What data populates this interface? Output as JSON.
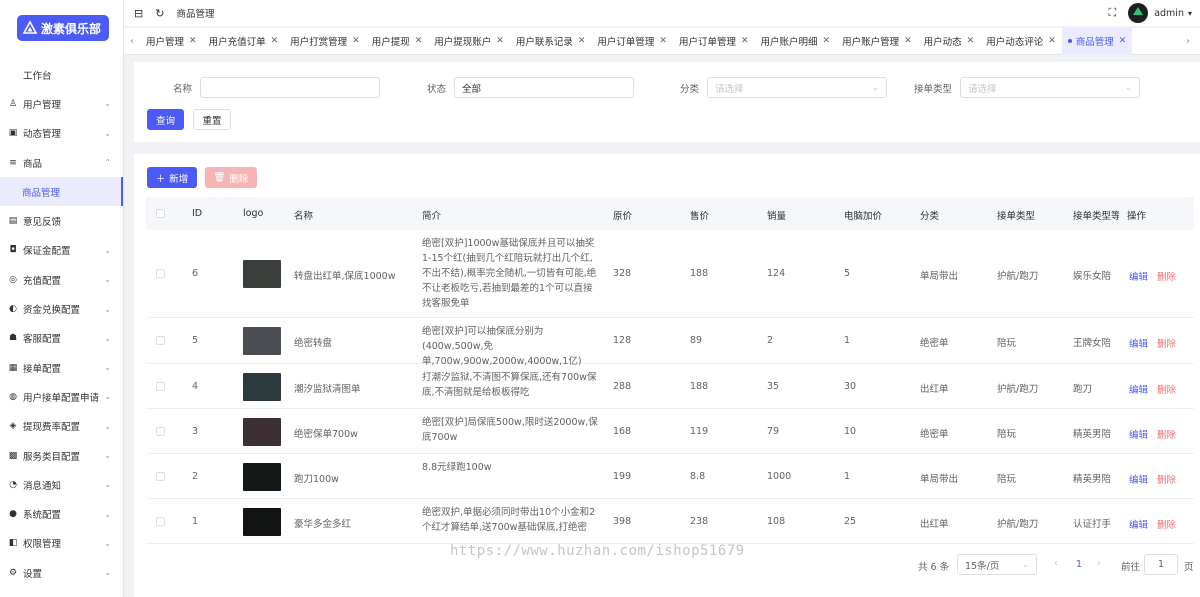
{
  "app": {
    "logo_text": "激素俱乐部"
  },
  "sidebar": {
    "items": [
      {
        "label": "工作台",
        "icon": "none",
        "type": "top"
      },
      {
        "label": "用户管理",
        "icon": "user-icon",
        "chev": "⌄"
      },
      {
        "label": "动态管理",
        "icon": "save-icon",
        "chev": "⌄"
      },
      {
        "label": "商品",
        "icon": "menu-icon",
        "chev": "⌃"
      },
      {
        "label": "商品管理",
        "type": "sub"
      },
      {
        "label": "意见反馈",
        "icon": "doc-icon",
        "chev": ""
      },
      {
        "label": "保证金配置",
        "icon": "cup-icon",
        "chev": "⌄"
      },
      {
        "label": "充值配置",
        "icon": "coins-icon",
        "chev": "⌄"
      },
      {
        "label": "资金兑换配置",
        "icon": "exchange-icon",
        "chev": "⌄"
      },
      {
        "label": "客服配置",
        "icon": "service-icon",
        "chev": "⌄"
      },
      {
        "label": "接单配置",
        "icon": "calendar-icon",
        "chev": "⌄"
      },
      {
        "label": "用户接单配置申请",
        "icon": "globe-icon",
        "chev": "⌄"
      },
      {
        "label": "提现费率配置",
        "icon": "rocket-icon",
        "chev": "⌄"
      },
      {
        "label": "服务类目配置",
        "icon": "grid-icon",
        "chev": "⌄"
      },
      {
        "label": "消息通知",
        "icon": "bell-icon",
        "chev": "⌄"
      },
      {
        "label": "系统配置",
        "icon": "check-icon",
        "chev": "⌄"
      },
      {
        "label": "权限管理",
        "icon": "lock-icon",
        "chev": "⌄"
      },
      {
        "label": "设置",
        "icon": "gear-icon",
        "chev": "⌄"
      }
    ]
  },
  "header": {
    "breadcrumb": "商品管理",
    "username": "admin"
  },
  "tabs": [
    {
      "label": "用户管理"
    },
    {
      "label": "用户充值订单"
    },
    {
      "label": "用户打赏管理"
    },
    {
      "label": "用户提现"
    },
    {
      "label": "用户提现账户"
    },
    {
      "label": "用户联系记录"
    },
    {
      "label": "用户订单管理"
    },
    {
      "label": "用户订单管理"
    },
    {
      "label": "用户账户明细"
    },
    {
      "label": "用户账户管理"
    },
    {
      "label": "用户动态"
    },
    {
      "label": "用户动态评论"
    },
    {
      "label": "商品管理",
      "active": true
    }
  ],
  "search": {
    "name_label": "名称",
    "name_value": "",
    "status_label": "状态",
    "status_value": "全部",
    "category_label": "分类",
    "category_placeholder": "请选择",
    "order_type_label": "接单类型",
    "order_type_placeholder": "请选择",
    "query_btn": "查询",
    "reset_btn": "重置"
  },
  "toolbar": {
    "add_btn": "新增",
    "delete_btn": "删除"
  },
  "table": {
    "headers": [
      "ID",
      "logo",
      "名称",
      "简介",
      "原价",
      "售价",
      "销量",
      "电脑加价",
      "分类",
      "接单类型",
      "接单类型等",
      "操作"
    ],
    "edit_label": "编辑",
    "delete_label": "删除",
    "rows": [
      {
        "id": "6",
        "name": "转盘出红单,保底1000w",
        "desc": "绝密[双护]1000w基础保底并且可以抽奖1-15个红(抽到几个红陪玩就打出几个红,不出不结),概率完全随机,一切皆有可能,绝不让老板吃亏,若抽到最差的1个可以直接找客服免单",
        "orig": "328",
        "price": "188",
        "sales": "124",
        "pc": "5",
        "cat": "单局带出",
        "otype": "护航/跑刀",
        "olevel": "娱乐女陪",
        "thumb": "#3a3f3c"
      },
      {
        "id": "5",
        "name": "绝密转盘",
        "desc": "绝密[双护]可以抽保底分别为(400w,500w,免单,700w,900w,2000w,4000w,1亿)",
        "orig": "128",
        "price": "89",
        "sales": "2",
        "pc": "1",
        "cat": "绝密单",
        "otype": "陪玩",
        "olevel": "王牌女陪",
        "thumb": "#4a4d52"
      },
      {
        "id": "4",
        "name": "潮汐监狱清图单",
        "desc": "打潮汐监狱,不清图不算保底,还有700w保底,不清图就是给板板得吃",
        "orig": "288",
        "price": "188",
        "sales": "35",
        "pc": "30",
        "cat": "出红单",
        "otype": "护航/跑刀",
        "olevel": "跑刀",
        "thumb": "#2d3a3d"
      },
      {
        "id": "3",
        "name": "绝密保单700w",
        "desc": "绝密[双护]局保底500w,限时送2000w,保底700w",
        "orig": "168",
        "price": "119",
        "sales": "79",
        "pc": "10",
        "cat": "绝密单",
        "otype": "陪玩",
        "olevel": "精英男陪",
        "thumb": "#3b2f33"
      },
      {
        "id": "2",
        "name": "跑刀100w",
        "desc": "8.8元绿跑100w",
        "orig": "199",
        "price": "8.8",
        "sales": "1000",
        "pc": "1",
        "cat": "单局带出",
        "otype": "陪玩",
        "olevel": "精英男陪",
        "thumb": "#141816"
      },
      {
        "id": "1",
        "name": "豪华多金多红",
        "desc": "绝密双护,单据必须同时带出10个小金和2个红才算结单,送700w基础保底,打绝密",
        "orig": "398",
        "price": "238",
        "sales": "108",
        "pc": "25",
        "cat": "出红单",
        "otype": "护航/跑刀",
        "olevel": "认证打手",
        "thumb": "#111413"
      }
    ]
  },
  "pagination": {
    "total": "共 6 条",
    "page_size": "15条/页",
    "current": "1",
    "goto_label": "前往",
    "goto_value": "1",
    "page_suffix": "页"
  },
  "watermark": "https://www.huzhan.com/ishop51679"
}
